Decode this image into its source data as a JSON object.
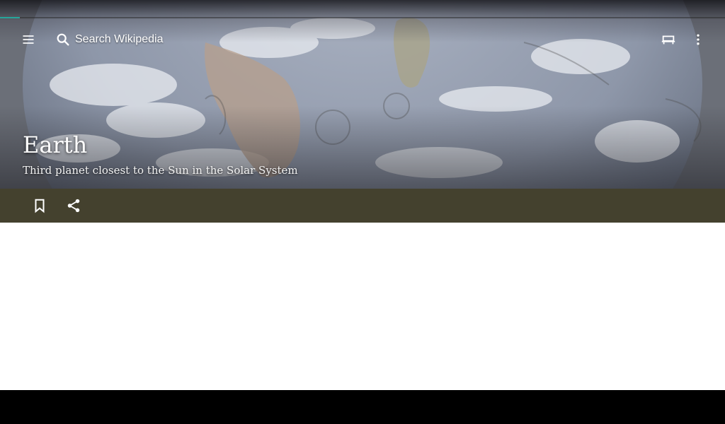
{
  "progress": {
    "value": 0.027,
    "color": "#26a69a"
  },
  "toolbar": {
    "menu_icon": "hamburger-menu-icon",
    "search_icon": "search-icon",
    "search_placeholder": "Search Wikipedia",
    "reading_list_icon": "reading-list-icon",
    "overflow_icon": "more-vert-icon"
  },
  "article": {
    "title": "Earth",
    "description": "Third planet closest to the Sun in the Solar System",
    "lead_image": "earth-from-space-image"
  },
  "actions": {
    "background": "#44412e",
    "save_icon": "bookmark-icon",
    "share_icon": "share-icon"
  }
}
